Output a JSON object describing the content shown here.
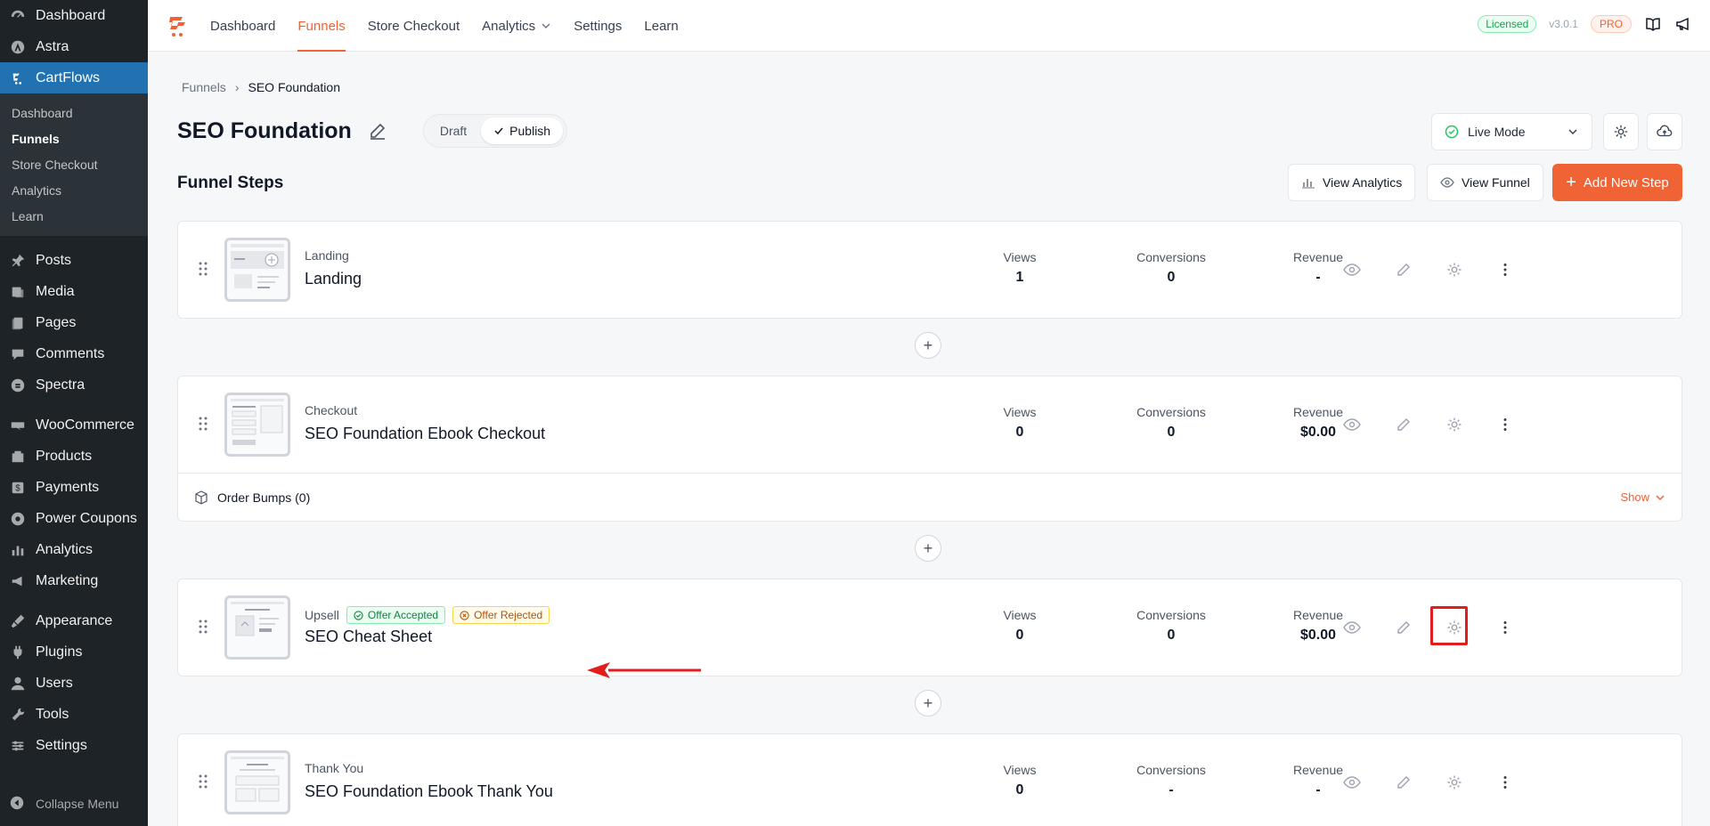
{
  "sidebar": {
    "items_top": [
      {
        "label": "Dashboard",
        "icon": "dashboard-icon"
      },
      {
        "label": "Astra",
        "icon": "astra-icon"
      },
      {
        "label": "CartFlows",
        "icon": "cartflows-icon"
      }
    ],
    "submenu": [
      "Dashboard",
      "Funnels",
      "Store Checkout",
      "Analytics",
      "Learn"
    ],
    "items_mid": [
      {
        "label": "Posts",
        "icon": "pin-icon"
      },
      {
        "label": "Media",
        "icon": "media-icon"
      },
      {
        "label": "Pages",
        "icon": "pages-icon"
      },
      {
        "label": "Comments",
        "icon": "comments-icon"
      },
      {
        "label": "Spectra",
        "icon": "spectra-icon"
      }
    ],
    "items_woo": [
      {
        "label": "WooCommerce",
        "icon": "woocommerce-icon"
      },
      {
        "label": "Products",
        "icon": "products-icon"
      },
      {
        "label": "Payments",
        "icon": "payments-icon"
      },
      {
        "label": "Power Coupons",
        "icon": "coupons-icon"
      },
      {
        "label": "Analytics",
        "icon": "analytics-icon"
      },
      {
        "label": "Marketing",
        "icon": "marketing-icon"
      }
    ],
    "items_bottom": [
      {
        "label": "Appearance",
        "icon": "appearance-icon"
      },
      {
        "label": "Plugins",
        "icon": "plugins-icon"
      },
      {
        "label": "Users",
        "icon": "users-icon"
      },
      {
        "label": "Tools",
        "icon": "tools-icon"
      },
      {
        "label": "Settings",
        "icon": "settings-icon"
      }
    ],
    "collapse": "Collapse Menu"
  },
  "topnav": {
    "items": [
      "Dashboard",
      "Funnels",
      "Store Checkout",
      "Analytics",
      "Settings",
      "Learn"
    ],
    "licensed": "Licensed",
    "version": "v3.0.1",
    "pro": "PRO"
  },
  "breadcrumb": {
    "parent": "Funnels",
    "current": "SEO Foundation"
  },
  "page": {
    "title": "SEO Foundation",
    "draft": "Draft",
    "publish": "Publish",
    "mode": "Live Mode",
    "section_title": "Funnel Steps",
    "view_analytics": "View Analytics",
    "view_funnel": "View Funnel",
    "add_step": "Add New Step"
  },
  "metric_labels": {
    "views": "Views",
    "conversions": "Conversions",
    "revenue": "Revenue"
  },
  "steps": [
    {
      "type": "Landing",
      "name": "Landing",
      "views": "1",
      "conversions": "0",
      "revenue": "-"
    },
    {
      "type": "Checkout",
      "name": "SEO Foundation Ebook Checkout",
      "views": "0",
      "conversions": "0",
      "revenue": "$0.00",
      "order_bumps": "Order Bumps (0)",
      "show": "Show"
    },
    {
      "type": "Upsell",
      "name": "SEO Cheat Sheet",
      "views": "0",
      "conversions": "0",
      "revenue": "$0.00",
      "tag_accepted": "Offer Accepted",
      "tag_rejected": "Offer Rejected"
    },
    {
      "type": "Thank You",
      "name": "SEO Foundation Ebook Thank You",
      "views": "0",
      "conversions": "-",
      "revenue": "-"
    }
  ],
  "colors": {
    "accent": "#f06335",
    "sidebar": "#1d2327",
    "wp_blue": "#2271b1",
    "highlight": "#e11d1d"
  }
}
